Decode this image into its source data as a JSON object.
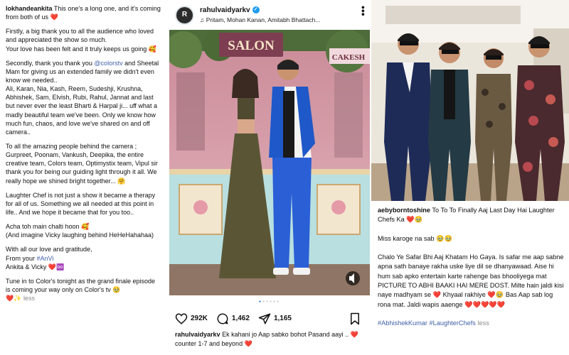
{
  "left_caption": {
    "username": "lokhandeankita",
    "intro": "This one's a long one, and it's coming from both of us ❤️",
    "para1": "Firstly, a big thank you to all the audience who loved and appreciated the show so much.\nYour love has been felt and it truly keeps us going 🥰",
    "para2_a": "Secondly, thank you thank you ",
    "para2_mention": "@colorstv",
    "para2_b": " and Sheetal Mam for giving us an extended family we didn't even know we needed..\nAli, Karan, Nia, Kash, Reem, Sudeshji, Krushna, Abhishek, Sam, Elvish, Rubi, Rahul, Jannat and last but never ever the least Bharti & Harpal ji... uff what a madly beautiful team we've been. Only we know how much fun, chaos, and love we've shared on and off camera..",
    "para3": "To all the amazing people behind the camera ; Gurpreet, Poonam, Vankush, Deepika, the entire creative team, Colors team, Optimystix team, Vipul sir thank you for being our guiding light through it all. We really hope we shined bright together... 🤗",
    "para4": "Laughter Chef is not just a show it became a therapy for all of us. Something we all needed at this point in life.. And we hope it became that for you too..",
    "para5": "Acha toh main chalti hoon 🥰\n(And imagine Vicky laughing behind HeHeHahahaa)",
    "para6_a": "With all our love and gratitude,\nFrom your ",
    "para6_tag": "#AnVi",
    "para6_b": "\nAnkita & Vicky ❤️♾️",
    "para7": "Tune in to Color's tonight as the grand finale episode is coming your way only on Color's tv 🥹",
    "para7_end": "❤️✨",
    "less_label": "less"
  },
  "middle_post": {
    "username": "rahulvaidyarkv",
    "verified": true,
    "music": "Pritam, Mohan Kanan, Amitabh Bhattach...",
    "likes": "292K",
    "comments": "1,462",
    "shares": "1,165",
    "caption_user": "rahulvaidyarkv",
    "caption_text": "Ek kahani jo Aap sabko bohot Pasand aayi .. ❤️ counter 1-7 and beyond ❤️",
    "photo_signs": [
      "SALON",
      "CAKESH"
    ],
    "carousel_total": 6,
    "carousel_active": 1
  },
  "right_post": {
    "username": "aebyborntoshine",
    "line1": " To To To Finally Aaj Last Day Hai Laughter Chefs Ka ❤️🥹",
    "line2": "Miss karoge na sab 🥹🥹",
    "line3": "Chalo Ye Safar Bhi Aaj Khatam Ho Gaya. Is safar me aap sabne apna sath banaye rakha uske liye dil se dhanyawaad. Aise hi hum sab apko entertain karte rahenge bas bhooliyega mat PICTURE TO ABHI BAAKI HAI MERE DOST. Milte hain jaldi kisi naye madhyam se ❤️ Khyaal rakhiye ❤️🥹 Bas Aap sab log rona mat. Jaldi wapis aaenge ❤️❤️❤️❤️❤️",
    "tags": "#AbhishekKumar #LaughterChefs",
    "less_label": "less"
  },
  "colors": {
    "link_blue": "#3f5fa8",
    "heart_red": "#e0245e",
    "verified_blue": "#1d9bf0",
    "carousel_active": "#1d6fe0"
  }
}
